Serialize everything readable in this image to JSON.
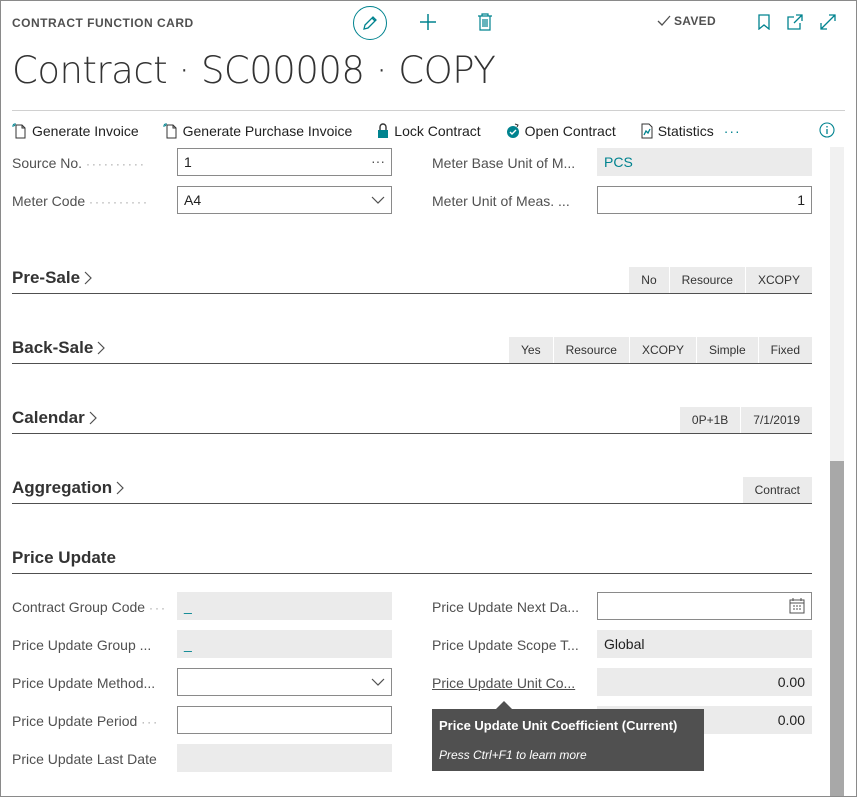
{
  "header": {
    "card_label": "CONTRACT FUNCTION CARD",
    "title": "Contract · SC00008 · COPY",
    "saved": "SAVED"
  },
  "actions": [
    {
      "label": "Generate Invoice",
      "icon": "generate-invoice-icon"
    },
    {
      "label": "Generate Purchase Invoice",
      "icon": "generate-purchase-invoice-icon"
    },
    {
      "label": "Lock Contract",
      "icon": "lock-icon"
    },
    {
      "label": "Open Contract",
      "icon": "open-contract-icon"
    },
    {
      "label": "Statistics",
      "icon": "statistics-icon"
    }
  ],
  "more": "···",
  "top_fields": {
    "source_no": {
      "label": "Source No.",
      "value": "1",
      "trail": "···"
    },
    "meter_code": {
      "label": "Meter Code",
      "value": "A4"
    },
    "meter_base_uom": {
      "label": "Meter Base Unit of M...",
      "value": "PCS"
    },
    "meter_uom": {
      "label": "Meter Unit of Meas. ...",
      "value": "1"
    }
  },
  "sections": {
    "pre_sale": {
      "title": "Pre-Sale",
      "chips": [
        "No",
        "Resource",
        "XCOPY"
      ]
    },
    "back_sale": {
      "title": "Back-Sale",
      "chips": [
        "Yes",
        "Resource",
        "XCOPY",
        "Simple",
        "Fixed"
      ]
    },
    "calendar": {
      "title": "Calendar",
      "chips": [
        "0P+1B",
        "7/1/2019"
      ]
    },
    "aggregation": {
      "title": "Aggregation",
      "chips": [
        "Contract"
      ]
    },
    "price_update": {
      "title": "Price Update"
    }
  },
  "price_fields": {
    "contract_group_code": {
      "label": "Contract Group Code",
      "value": "_"
    },
    "price_update_group": {
      "label": "Price Update Group ...",
      "value": "_"
    },
    "price_update_method": {
      "label": "Price Update Method...",
      "value": ""
    },
    "price_update_period": {
      "label": "Price Update Period",
      "value": ""
    },
    "price_update_last_date": {
      "label": "Price Update Last Date",
      "value": ""
    },
    "price_update_next_date": {
      "label": "Price Update Next Da...",
      "value": ""
    },
    "price_update_scope": {
      "label": "Price Update Scope T...",
      "value": "Global"
    },
    "price_update_unit_coeff": {
      "label": "Price Update Unit Co...",
      "value": "0.00"
    },
    "price_update_unit_coeff_2": {
      "value": "0.00"
    }
  },
  "tooltip": {
    "title": "Price Update Unit Coefficient (Current)",
    "hint": "Press Ctrl+F1 to learn more"
  },
  "colors": {
    "accent": "#00838f",
    "readonly_bg": "#ebebeb",
    "tooltip_bg": "#505050"
  }
}
